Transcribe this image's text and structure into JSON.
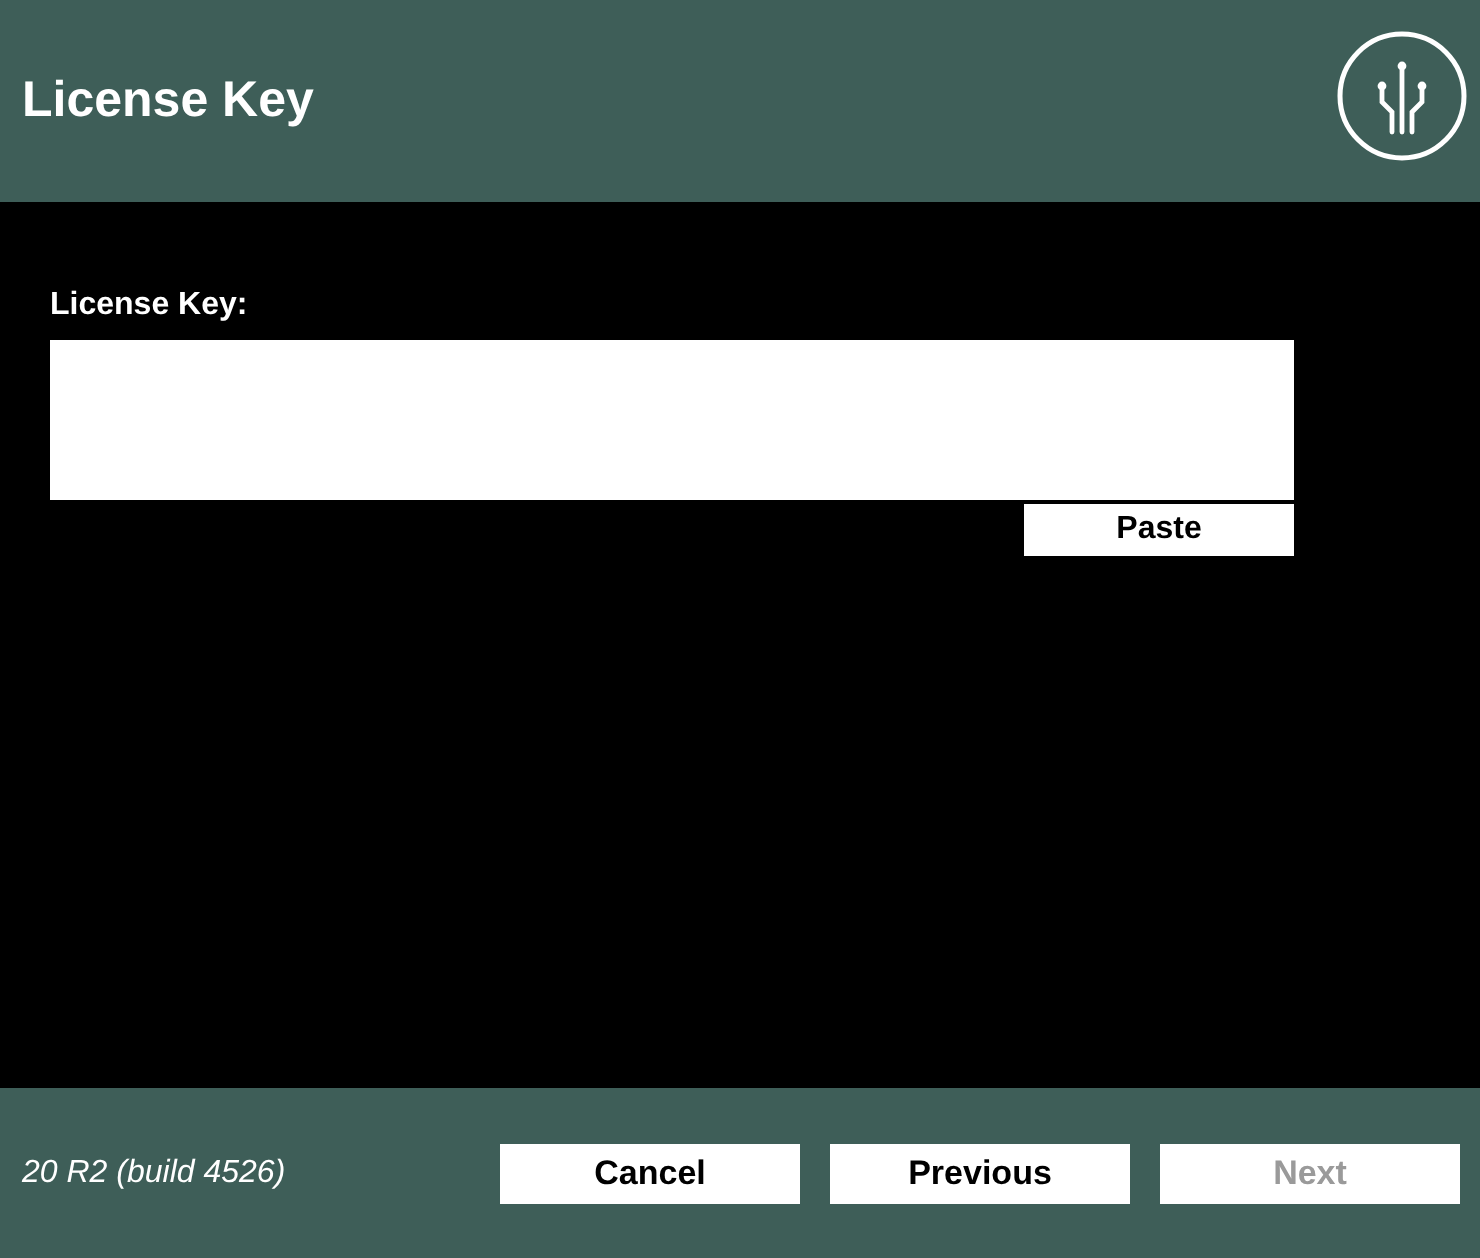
{
  "header": {
    "title": "License Key"
  },
  "form": {
    "label": "License Key:",
    "paste_button": "Paste"
  },
  "footer": {
    "version": "20 R2 (build 4526)",
    "buttons": [
      {
        "label": "Cancel",
        "disabled": false
      },
      {
        "label": "Previous",
        "disabled": false
      },
      {
        "label": "Next",
        "disabled": true
      }
    ]
  }
}
